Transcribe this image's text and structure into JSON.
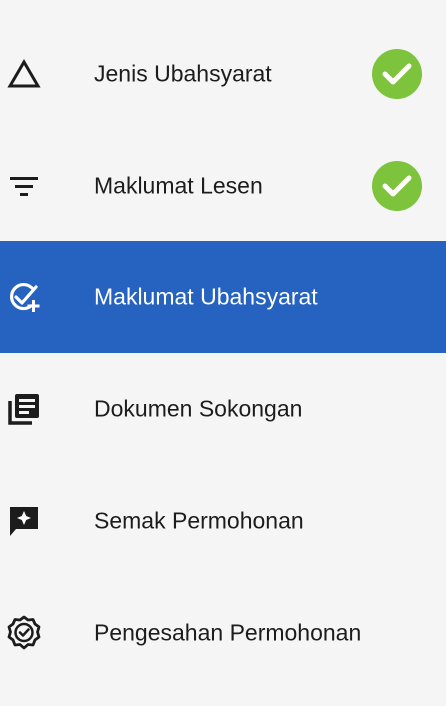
{
  "steps": [
    {
      "label": "Jenis Ubahsyarat",
      "icon": "triangle-outline-icon",
      "completed": true
    },
    {
      "label": "Maklumat Lesen",
      "icon": "filter-icon",
      "completed": true
    },
    {
      "label": "Maklumat Ubahsyarat",
      "icon": "check-add-icon",
      "active": true
    },
    {
      "label": "Dokumen Sokongan",
      "icon": "library-books-icon"
    },
    {
      "label": "Semak Permohonan",
      "icon": "review-star-icon"
    },
    {
      "label": "Pengesahan Permohonan",
      "icon": "verified-badge-icon"
    }
  ],
  "colors": {
    "active_bg": "#2662bf",
    "check_green": "#7dc33b",
    "background": "#f5f5f5",
    "text": "#1c1c1c"
  }
}
